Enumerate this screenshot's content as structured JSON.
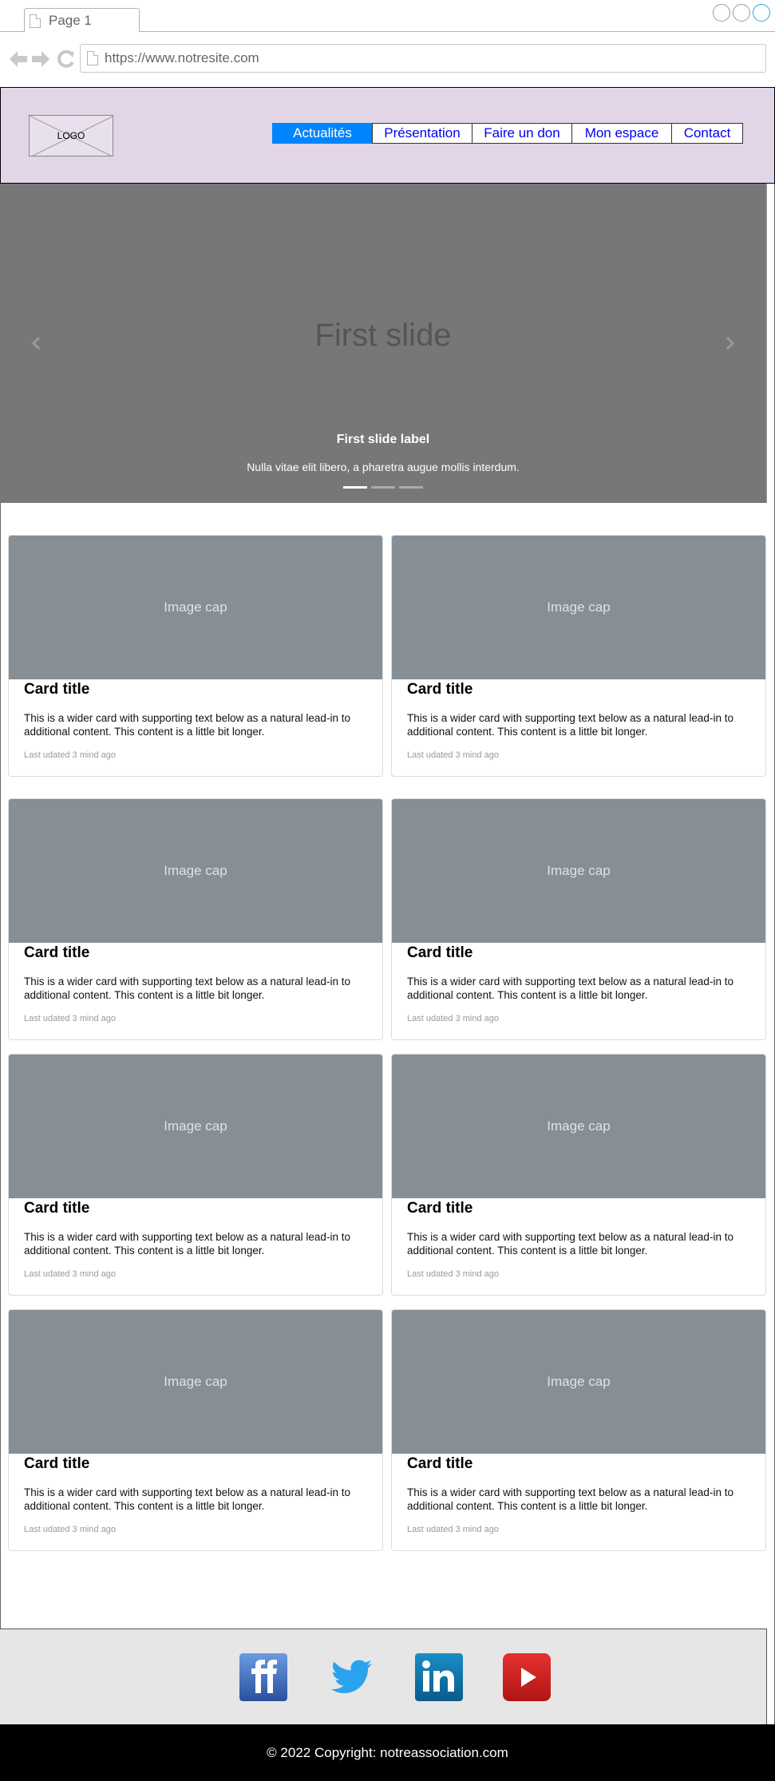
{
  "browser": {
    "tab_label": "Page 1",
    "url": "https://www.notresite.com"
  },
  "header": {
    "logo_text": "LOGO",
    "menu": [
      {
        "label": "Actualités",
        "active": true
      },
      {
        "label": "Présentation",
        "active": false
      },
      {
        "label": "Faire un don",
        "active": false
      },
      {
        "label": "Mon espace",
        "active": false
      },
      {
        "label": "Contact",
        "active": false
      }
    ]
  },
  "carousel": {
    "slide_text": "First slide",
    "label": "First slide label",
    "caption": "Nulla vitae elit libero, a pharetra augue mollis interdum.",
    "slide_count": 3,
    "active_index": 0
  },
  "cards": [
    {
      "image_text": "Image cap",
      "title": "Card title",
      "text": "This is a wider card with supporting text below as a natural lead-in to additional content. This content is a little bit longer.",
      "meta": "Last udated 3 mind ago"
    },
    {
      "image_text": "Image cap",
      "title": "Card title",
      "text": "This is a wider card with supporting text below as a natural lead-in to additional content. This content is a little bit longer.",
      "meta": "Last udated 3 mind ago"
    },
    {
      "image_text": "Image cap",
      "title": "Card title",
      "text": "This is a wider card with supporting text below as a natural lead-in to additional content. This content is a little bit longer.",
      "meta": "Last udated 3 mind ago"
    },
    {
      "image_text": "Image cap",
      "title": "Card title",
      "text": "This is a wider card with supporting text below as a natural lead-in to additional content. This content is a little bit longer.",
      "meta": "Last udated 3 mind ago"
    },
    {
      "image_text": "Image cap",
      "title": "Card title",
      "text": "This is a wider card with supporting text below as a natural lead-in to additional content. This content is a little bit longer.",
      "meta": "Last udated 3 mind ago"
    },
    {
      "image_text": "Image cap",
      "title": "Card title",
      "text": "This is a wider card with supporting text below as a natural lead-in to additional content. This content is a little bit longer.",
      "meta": "Last udated 3 mind ago"
    },
    {
      "image_text": "Image cap",
      "title": "Card title",
      "text": "This is a wider card with supporting text below as a natural lead-in to additional content. This content is a little bit longer.",
      "meta": "Last udated 3 mind ago"
    },
    {
      "image_text": "Image cap",
      "title": "Card title",
      "text": "This is a wider card with supporting text below as a natural lead-in to additional content. This content is a little bit longer.",
      "meta": "Last udated 3 mind ago"
    }
  ],
  "footer": {
    "social_icons": [
      "facebook-icon",
      "twitter-icon",
      "linkedin-icon",
      "youtube-icon"
    ],
    "copyright": "© 2022 Copyright: notreassociation.com"
  },
  "colors": {
    "header_bg": "#e1d5e7",
    "menu_active": "#0085fc",
    "carousel_bg": "#777777",
    "image_cap_bg": "#868e96",
    "footer_bg": "#e6e6e6"
  }
}
